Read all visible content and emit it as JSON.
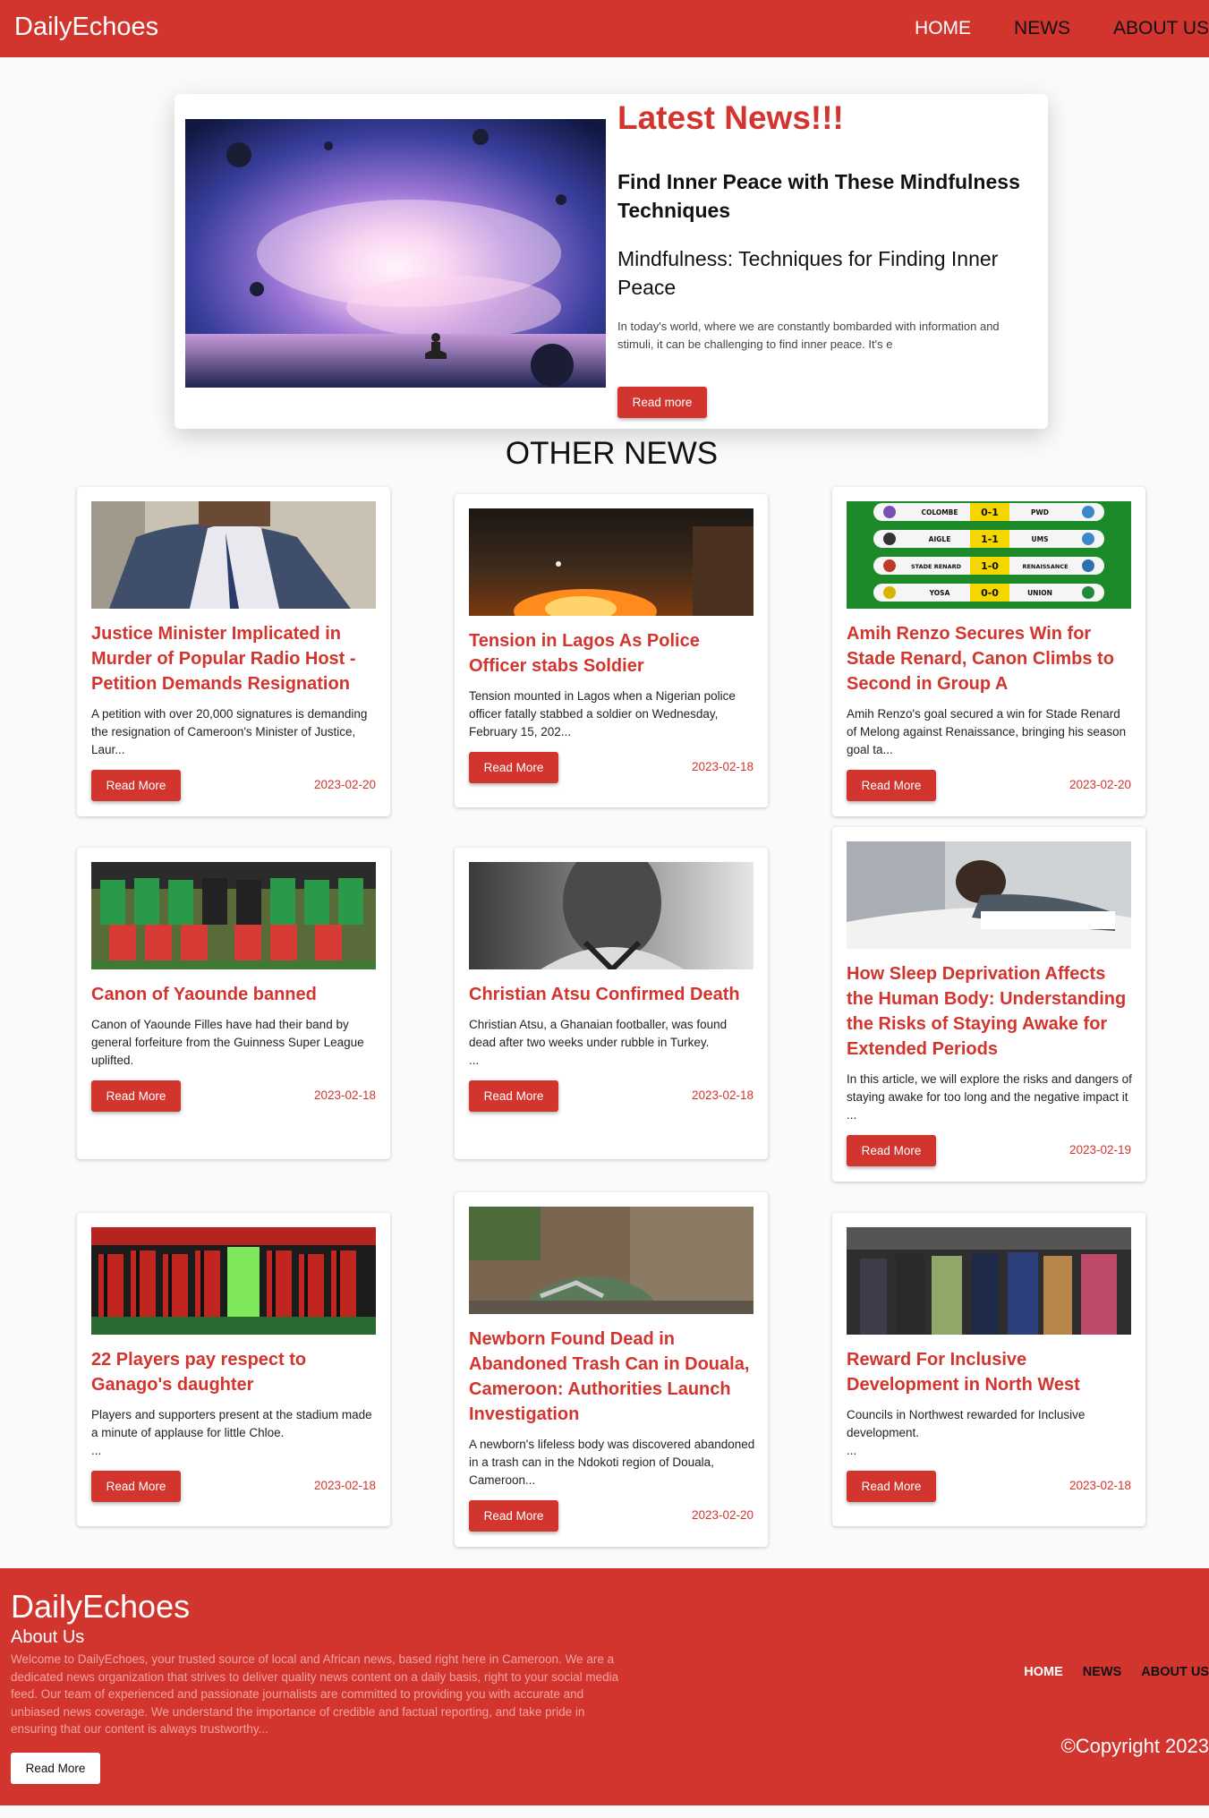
{
  "nav": {
    "brand": "DailyEchoes",
    "links": [
      "HOME",
      "NEWS",
      "ABOUT US"
    ]
  },
  "hero": {
    "heading": "Latest News!!!",
    "title": "Find Inner Peace with These Mindfulness Techniques",
    "subtitle": "Mindfulness: Techniques for Finding Inner Peace",
    "text": "In today's world, where we are constantly bombarded with information and stimuli, it can be challenging to find inner peace. It's e",
    "button": "Read more"
  },
  "other_news": {
    "heading": "OTHER NEWS"
  },
  "cards": [
    {
      "title": "Justice Minister Implicated in Murder of Popular Radio Host - Petition Demands Resignation",
      "text": "A petition with over 20,000 signatures is demanding the resignation of Cameroon's Minister of Justice, Laur...",
      "button": "Read More",
      "date": "2023-02-20"
    },
    {
      "title": "Tension in Lagos As Police Officer stabs Soldier",
      "text": "Tension mounted in Lagos when a Nigerian police officer fatally stabbed a soldier on Wednesday, February 15, 202...",
      "button": "Read More",
      "date": "2023-02-18"
    },
    {
      "title": "Amih Renzo Secures Win for Stade Renard, Canon Climbs to Second in Group A",
      "text": "Amih Renzo's goal secured a win for Stade Renard of Melong against Renaissance, bringing his season goal ta...",
      "button": "Read More",
      "date": "2023-02-20",
      "scoreboard": [
        {
          "home": "COLOMBE",
          "score": "0-1",
          "away": "PWD"
        },
        {
          "home": "AIGLE",
          "score": "1-1",
          "away": "UMS"
        },
        {
          "home": "STADE RENARD",
          "score": "1-0",
          "away": "RENAISSANCE"
        },
        {
          "home": "YOSA",
          "score": "0-0",
          "away": "UNION"
        }
      ]
    },
    {
      "title": "Canon of Yaounde banned",
      "text": "Canon of Yaounde Filles have had their band by general forfeiture from the Guinness Super League uplifted.",
      "button": "Read More",
      "date": "2023-02-18"
    },
    {
      "title": "Christian Atsu Confirmed Death",
      "text": "Christian Atsu, a Ghanaian footballer, was found dead after two weeks under rubble in Turkey.",
      "ellipsis": "...",
      "button": "Read More",
      "date": "2023-02-18"
    },
    {
      "title": "How Sleep Deprivation Affects the Human Body: Understanding the Risks of Staying Awake for Extended Periods",
      "text": "In this article, we will explore the risks and dangers of staying awake for too long and the negative impact it ...",
      "button": "Read More",
      "date": "2023-02-19"
    },
    {
      "title": "22 Players pay respect to Ganago's daughter",
      "text": "Players and supporters present at the stadium made a minute of applause for little Chloe.",
      "ellipsis": "...",
      "button": "Read More",
      "date": "2023-02-18"
    },
    {
      "title": "Newborn Found Dead in Abandoned Trash Can in Douala, Cameroon: Authorities Launch Investigation",
      "text": "A newborn's lifeless body was discovered abandoned in a trash can in the Ndokoti region of Douala, Cameroon...",
      "button": "Read More",
      "date": "2023-02-20"
    },
    {
      "title": "Reward For Inclusive Development in North West",
      "text": "Councils in Northwest rewarded for Inclusive development.",
      "ellipsis": "...",
      "button": "Read More",
      "date": "2023-02-18"
    }
  ],
  "footer": {
    "brand": "DailyEchoes",
    "about_heading": "About Us",
    "about_text": "Welcome to DailyEchoes, your trusted source of local and African news, based right here in Cameroon. We are a dedicated news organization that strives to deliver quality news content on a daily basis, right to your social media feed. Our team of experienced and passionate journalists are committed to providing you with accurate and unbiased news coverage. We understand the importance of credible and factual reporting, and take pride in ensuring that our content is always trustworthy...",
    "button": "Read More",
    "links": [
      "HOME",
      "NEWS",
      "ABOUT US"
    ],
    "copyright_symbol": "©",
    "copyright": "Copyright 2023"
  },
  "colors": {
    "brand_red": "#d2352e",
    "background": "#fafafa"
  }
}
